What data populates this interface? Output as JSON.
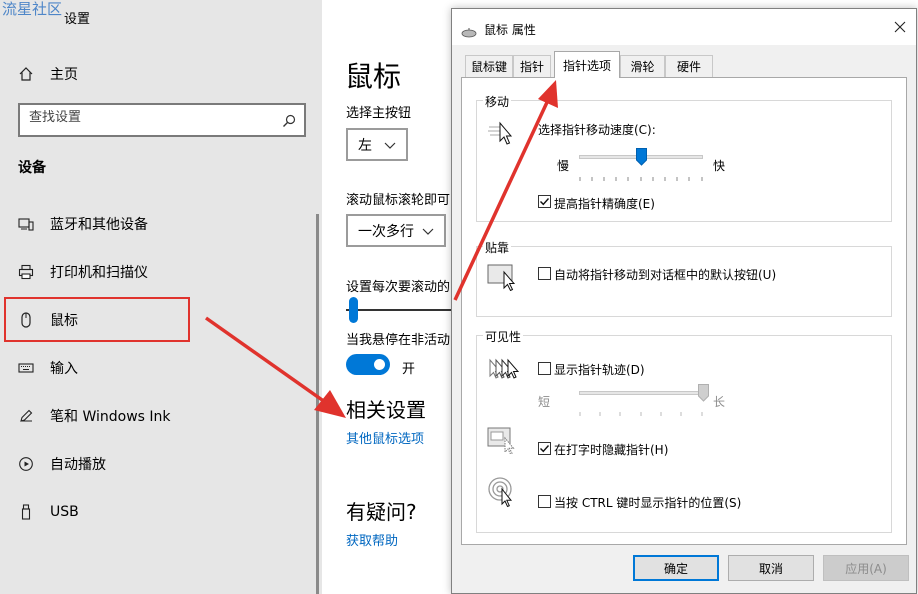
{
  "watermark": "流星社区",
  "settings": {
    "window_title": "设置",
    "home_label": "主页",
    "search_placeholder": "查找设置",
    "section_title": "设备",
    "nav": [
      {
        "label": "蓝牙和其他设备",
        "icon": "bluetooth-devices-icon"
      },
      {
        "label": "打印机和扫描仪",
        "icon": "printer-icon"
      },
      {
        "label": "鼠标",
        "icon": "mouse-icon"
      },
      {
        "label": "输入",
        "icon": "keyboard-icon"
      },
      {
        "label": "笔和 Windows Ink",
        "icon": "pen-icon"
      },
      {
        "label": "自动播放",
        "icon": "autoplay-icon"
      },
      {
        "label": "USB",
        "icon": "usb-icon"
      }
    ],
    "selected_nav": "鼠标"
  },
  "content": {
    "title": "鼠标",
    "primary_button_label": "选择主按钮",
    "primary_button_value": "左",
    "scroll_label": "滚动鼠标滚轮即可",
    "scroll_value": "一次多行",
    "lines_label": "设置每次要滚动的",
    "hover_label": "当我悬停在非活动",
    "toggle_state": "开",
    "related_title": "相关设置",
    "related_link": "其他鼠标选项",
    "question_title": "有疑问?",
    "help_link": "获取帮助"
  },
  "dialog": {
    "title": "鼠标 属性",
    "tabs": [
      "鼠标键",
      "指针",
      "指针选项",
      "滑轮",
      "硬件"
    ],
    "active_tab": "指针选项",
    "motion": {
      "group_label": "移动",
      "speed_label": "选择指针移动速度(C):",
      "slow_label": "慢",
      "fast_label": "快",
      "speed_value": 0.5,
      "precision_label": "提高指针精确度(E)",
      "precision_checked": true
    },
    "snap": {
      "group_label": "贴靠",
      "snap_label": "自动将指针移动到对话框中的默认按钮(U)",
      "snap_checked": false
    },
    "visibility": {
      "group_label": "可见性",
      "trails_label": "显示指针轨迹(D)",
      "trails_checked": false,
      "short_label": "短",
      "long_label": "长",
      "trails_value": 1.0,
      "hide_label": "在打字时隐藏指针(H)",
      "hide_checked": true,
      "ctrl_label": "当按 CTRL 键时显示指针的位置(S)",
      "ctrl_checked": false
    },
    "buttons": {
      "ok": "确定",
      "cancel": "取消",
      "apply": "应用(A)"
    }
  },
  "colors": {
    "accent": "#0078d7",
    "annotation": "#e0332d",
    "link": "#0067c0"
  }
}
